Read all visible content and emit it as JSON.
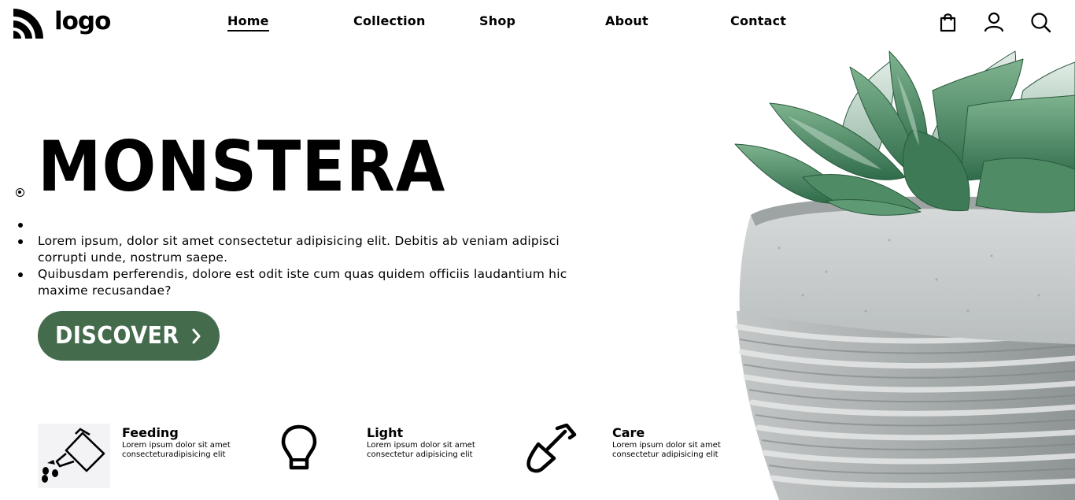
{
  "header": {
    "logo_text": "logo",
    "nav": [
      {
        "label": "Home",
        "active": true
      },
      {
        "label": "Collection",
        "active": false
      },
      {
        "label": "Shop",
        "active": false
      },
      {
        "label": "About",
        "active": false
      },
      {
        "label": "Contact",
        "active": false
      }
    ],
    "icons": [
      "shopping-bag-icon",
      "user-icon",
      "search-icon"
    ]
  },
  "hero": {
    "title": "MONSTERA",
    "paragraphs": [
      "Lorem ipsum, dolor sit amet consectetur adipisicing elit. Debitis ab veniam adipisci corrupti unde, nostrum saepe.",
      "Quibusdam perferendis, dolore est odit iste cum quas quidem officiis laudantium hic maxime recusandae?"
    ],
    "cta_label": "DISCOVER",
    "cta_icon": "chevron-right-icon",
    "cta_color": "#456b4d"
  },
  "features": [
    {
      "title": "Feeding",
      "line1": "Lorem ipsum dolor sit amet",
      "line2": "consecteturadipisicing elit",
      "icon": "watering-can-icon"
    },
    {
      "title": "Light",
      "line1": "Lorem ipsum dolor sit amet",
      "line2": "consectetur adipisicing elit",
      "icon": "light-bulb-icon"
    },
    {
      "title": "Care",
      "line1": "Lorem ipsum dolor sit amet",
      "line2": "consectetur adipisicing elit",
      "icon": "shovel-icon"
    }
  ],
  "colors": {
    "accent": "#456b4d",
    "text": "#000000",
    "background": "#ffffff"
  }
}
